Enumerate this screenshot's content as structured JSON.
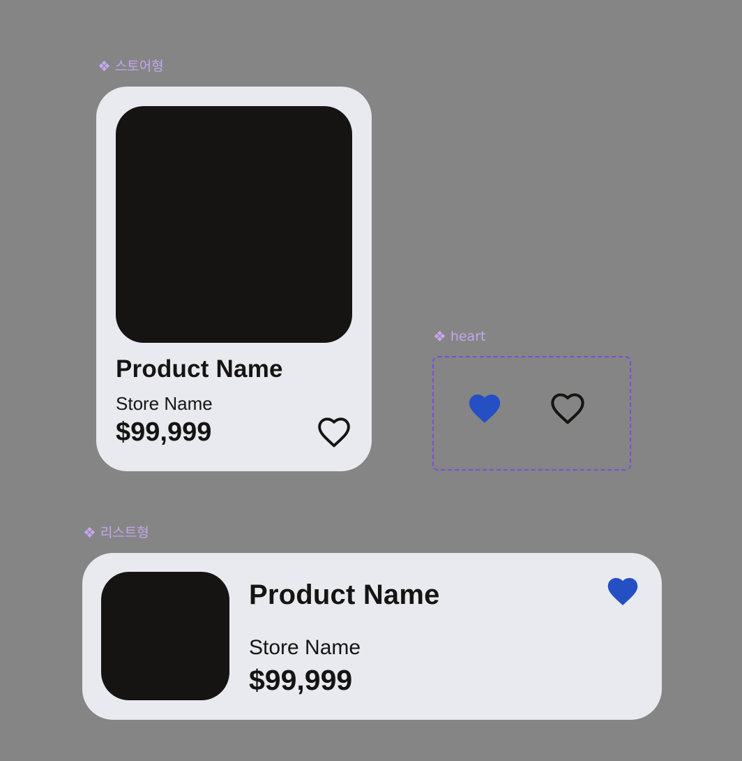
{
  "store_card": {
    "label": "스토어형",
    "label_icon": "component-icon",
    "product_name": "Product Name",
    "store_name": "Store Name",
    "price": "$99,999",
    "heart_state": "outline"
  },
  "heart_component": {
    "label": "heart",
    "label_icon": "component-icon",
    "variants": [
      "filled",
      "outline"
    ]
  },
  "list_card": {
    "label": "리스트형",
    "label_icon": "component-icon",
    "product_name": "Product Name",
    "store_name": "Store Name",
    "price": "$99,999",
    "heart_state": "filled"
  },
  "colors": {
    "canvas": "#858585",
    "card": "#e9eaef",
    "thumbnail": "#151412",
    "text": "#151413",
    "heart_filled": "#2450c4",
    "component_label": "#c5a6ef",
    "component_border": "#7b4ae0"
  }
}
